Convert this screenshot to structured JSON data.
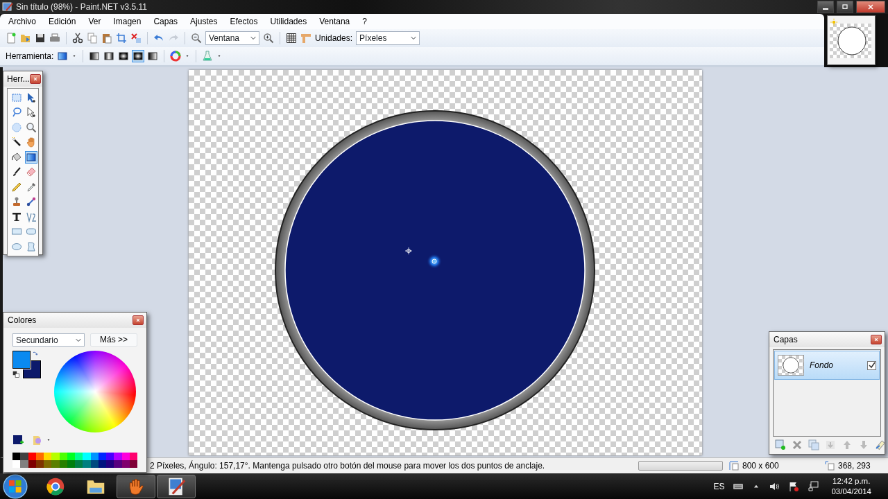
{
  "window": {
    "title": "Sin título (98%) - Paint.NET v3.5.11"
  },
  "menu": [
    "Archivo",
    "Edición",
    "Ver",
    "Imagen",
    "Capas",
    "Ajustes",
    "Efectos",
    "Utilidades",
    "Ventana",
    "?"
  ],
  "toolbar": {
    "zoom": "Ventana",
    "units_label": "Unidades:",
    "units": "Píxeles"
  },
  "tool_options": {
    "label": "Herramienta:",
    "gradient_modes": [
      {
        "kind": "linear",
        "selected": false
      },
      {
        "kind": "reflected",
        "selected": false
      },
      {
        "kind": "diamond",
        "selected": false
      },
      {
        "kind": "radial",
        "selected": true
      },
      {
        "kind": "conical",
        "selected": false
      }
    ]
  },
  "tools_window": {
    "title": "Herr...",
    "tools": [
      {
        "kind": "rectselect",
        "selected": false
      },
      {
        "kind": "move",
        "selected": false
      },
      {
        "kind": "lasso",
        "selected": false
      },
      {
        "kind": "moveselection",
        "selected": false
      },
      {
        "kind": "ellipseselect",
        "selected": false
      },
      {
        "kind": "zoom",
        "selected": false
      },
      {
        "kind": "wand",
        "selected": false
      },
      {
        "kind": "pan",
        "selected": false
      },
      {
        "kind": "bucket",
        "selected": false
      },
      {
        "kind": "gradient",
        "selected": true
      },
      {
        "kind": "brush",
        "selected": false
      },
      {
        "kind": "eraser",
        "selected": false
      },
      {
        "kind": "pencil",
        "selected": false
      },
      {
        "kind": "picker",
        "selected": false
      },
      {
        "kind": "clone",
        "selected": false
      },
      {
        "kind": "recolor",
        "selected": false
      },
      {
        "kind": "text",
        "selected": false
      },
      {
        "kind": "line",
        "selected": false
      },
      {
        "kind": "rectangle",
        "selected": false
      },
      {
        "kind": "roundrect",
        "selected": false
      },
      {
        "kind": "ellipse",
        "selected": false
      },
      {
        "kind": "freeform",
        "selected": false
      }
    ]
  },
  "colors_window": {
    "title": "Colores",
    "mode": "Secundario",
    "more_button": "Más >>",
    "primary": {
      "color": "#0a8af0"
    },
    "secondary": {
      "color": "#0d1a6b"
    },
    "palette": [
      {
        "color": "#000000"
      },
      {
        "color": "#404040"
      },
      {
        "color": "#ff0000"
      },
      {
        "color": "#ff6a00"
      },
      {
        "color": "#ffd800"
      },
      {
        "color": "#b6ff00"
      },
      {
        "color": "#4cff00"
      },
      {
        "color": "#00ff21"
      },
      {
        "color": "#00ff90"
      },
      {
        "color": "#00ffff"
      },
      {
        "color": "#0094ff"
      },
      {
        "color": "#0026ff"
      },
      {
        "color": "#4800ff"
      },
      {
        "color": "#b200ff"
      },
      {
        "color": "#ff00dc"
      },
      {
        "color": "#ff006e"
      },
      {
        "color": "#ffffff"
      },
      {
        "color": "#808080"
      },
      {
        "color": "#7f0000"
      },
      {
        "color": "#7f3300"
      },
      {
        "color": "#7f6a00"
      },
      {
        "color": "#5b7f00"
      },
      {
        "color": "#267f00"
      },
      {
        "color": "#007f0e"
      },
      {
        "color": "#007f46"
      },
      {
        "color": "#007f7f"
      },
      {
        "color": "#004a7f"
      },
      {
        "color": "#00137f"
      },
      {
        "color": "#21007f"
      },
      {
        "color": "#57007f"
      },
      {
        "color": "#7f006e"
      },
      {
        "color": "#7f0037"
      }
    ]
  },
  "layers_window": {
    "title": "Capas",
    "layers": [
      {
        "name": "Fondo",
        "visible": true,
        "selected": true
      }
    ]
  },
  "status_bar": {
    "message": "2 Píxeles, Ángulo: 157,17°. Mantenga pulsado otro botón del mouse para mover los dos puntos de anclaje.",
    "size": "800 x 600",
    "cursor": "368, 293"
  },
  "taskbar": {
    "apps": [
      {
        "kind": "browser",
        "active": false
      },
      {
        "kind": "folder",
        "active": false
      },
      {
        "kind": "glove",
        "active": true
      },
      {
        "kind": "paint",
        "active": true
      }
    ],
    "language": "ES",
    "time": "12:42 p.m.",
    "date": "03/04/2014"
  }
}
